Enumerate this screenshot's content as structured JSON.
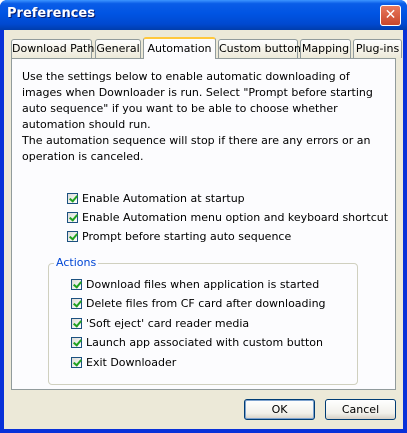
{
  "window": {
    "title": "Preferences",
    "close_glyph": "✕"
  },
  "tabs": [
    {
      "label": "Download Path",
      "active": false
    },
    {
      "label": "General",
      "active": false
    },
    {
      "label": "Automation",
      "active": true
    },
    {
      "label": "Custom button",
      "active": false
    },
    {
      "label": "Mapping",
      "active": false
    },
    {
      "label": "Plug-ins",
      "active": false
    }
  ],
  "description": {
    "line1": "Use the settings below to enable automatic downloading of images when Downloader is run. Select \"Prompt before starting auto sequence\" if you want to be able to choose whether automation should run.",
    "line2": "The automation sequence will stop if there are any errors or an operation is canceled."
  },
  "options": [
    {
      "label": "Enable Automation at startup",
      "checked": true
    },
    {
      "label": "Enable Automation menu option and keyboard shortcut",
      "checked": true
    },
    {
      "label": "Prompt before starting auto sequence",
      "checked": true
    }
  ],
  "actions": {
    "legend": "Actions",
    "items": [
      {
        "label": "Download files when application is started",
        "checked": true
      },
      {
        "label": "Delete files from CF card after downloading",
        "checked": true
      },
      {
        "label": "'Soft eject' card reader media",
        "checked": true
      },
      {
        "label": "Launch app associated with custom button",
        "checked": true
      },
      {
        "label": "Exit Downloader",
        "checked": true
      }
    ]
  },
  "buttons": {
    "ok": "OK",
    "cancel": "Cancel"
  }
}
